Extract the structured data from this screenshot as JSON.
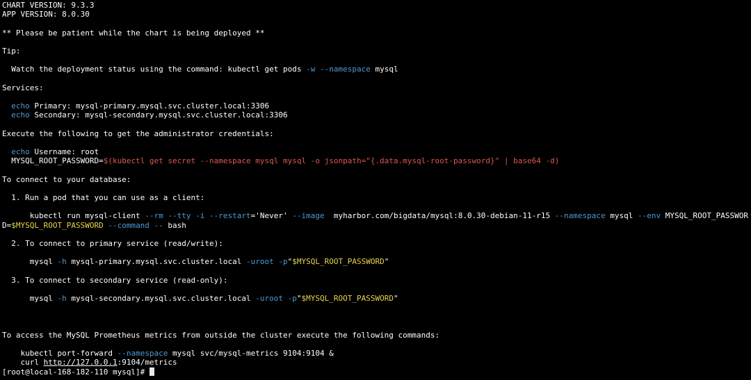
{
  "terminal": {
    "chart_version": "CHART VERSION: 9.3.3",
    "app_version": "APP VERSION: 8.0.30",
    "patience": "** Please be patient while the chart is being deployed **",
    "tip": "Tip:",
    "watch": {
      "prefix": "  Watch the deployment status using the command: kubectl get pods ",
      "flag_w": "-w",
      "space": " ",
      "flag_ns": "--namespace",
      "suffix": " mysql"
    },
    "services_header": "Services:",
    "svc_primary": {
      "echo": "  echo",
      "text": " Primary: mysql-primary.mysql.svc.cluster.local:3306"
    },
    "svc_secondary": {
      "echo": "  echo",
      "text": " Secondary: mysql-secondary.mysql.svc.cluster.local:3306"
    },
    "creds_header": "Execute the following to get the administrator credentials:",
    "username": {
      "echo": "  echo",
      "text": " Username: root"
    },
    "root_pw": {
      "var": "  MYSQL_ROOT_PASSWORD=",
      "cmd": "$(kubectl get secret --namespace mysql mysql -o jsonpath=\"{.data.mysql-root-password}\" | base64 -d)"
    },
    "connect_header": "To connect to your database:",
    "step1": "  1. Run a pod that you can use as a client:",
    "run_line1": {
      "a": "      kubectl run mysql-client ",
      "rm": "--rm",
      "sp1": " ",
      "tty": "--tty",
      "sp2": " ",
      "i": "-i",
      "sp3": " ",
      "restart": "--restart",
      "restart_val": "='Never' ",
      "image": "--image",
      "image_val": "  myharbor.com/bigdata/mysql:8.0.30-debian-11-r15 ",
      "ns": "--namespace",
      "ns_val": " mysql ",
      "env": "--env",
      "env_val": " MYSQL_ROOT_PASSWOR"
    },
    "run_line2": {
      "a": "D=",
      "var": "$MYSQL_ROOT_PASSWORD",
      "sp": " ",
      "command": "--command",
      "sp2": " ",
      "dd": "--",
      "rest": " bash"
    },
    "step2": "  2. To connect to primary service (read/write):",
    "mysql_primary": {
      "a": "      mysql ",
      "h": "-h",
      "host": " mysql-primary.mysql.svc.cluster.local ",
      "u": "-uroot",
      "sp": " ",
      "p": "-p",
      "q1": "\"",
      "var": "$MYSQL_ROOT_PASSWORD",
      "q2": "\""
    },
    "step3": "  3. To connect to secondary service (read-only):",
    "mysql_secondary": {
      "a": "      mysql ",
      "h": "-h",
      "host": " mysql-secondary.mysql.svc.cluster.local ",
      "u": "-uroot",
      "sp": " ",
      "p": "-p",
      "q1": "\"",
      "var": "$MYSQL_ROOT_PASSWORD",
      "q2": "\""
    },
    "metrics_header": "To access the MySQL Prometheus metrics from outside the cluster execute the following commands:",
    "port_forward": {
      "a": "    kubectl port-forward ",
      "ns": "--namespace",
      "rest": " mysql svc/mysql-metrics 9104:9104 &"
    },
    "curl": {
      "a": "    curl ",
      "url": "http://127.0.0.1",
      "rest": ":9104/metrics"
    },
    "prompt": "[root@local-168-182-110 mysql]# "
  },
  "colors": {
    "background": "#000000",
    "text": "#ffffff",
    "flag_blue": "#4f9bd6",
    "command_red": "#e0574f",
    "variable_yellow": "#e8d44d"
  }
}
